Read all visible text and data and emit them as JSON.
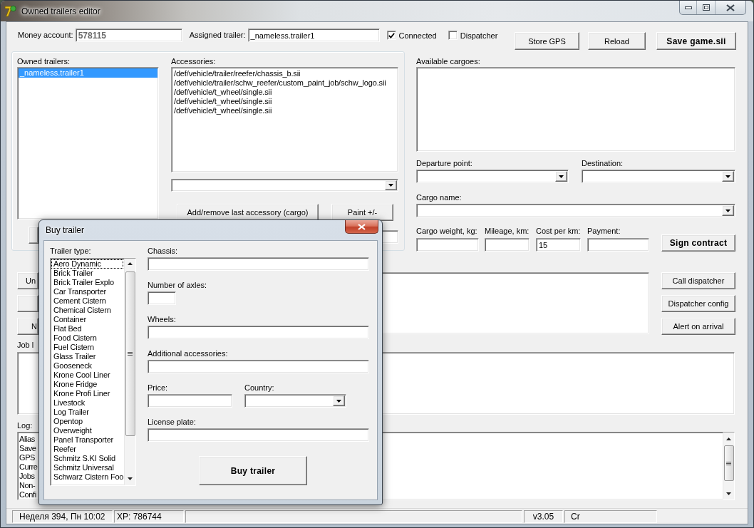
{
  "window": {
    "title": "Owned trailers editor"
  },
  "header": {
    "money_account": {
      "label": "Money account:",
      "value": "578115"
    },
    "assigned_trailer": {
      "label": "Assigned trailer:",
      "value": "_nameless.trailer1"
    },
    "checkboxes": [
      {
        "label": "Connected",
        "checked": true
      },
      {
        "label": "Dispatcher",
        "checked": false
      }
    ],
    "buttons": [
      {
        "label": "Store GPS",
        "kind": "plain"
      },
      {
        "label": "Reload",
        "kind": "plain"
      },
      {
        "label": "Save game.sii",
        "kind": "bold"
      }
    ]
  },
  "owned_trailers": {
    "label": "Owned trailers:",
    "items": [
      {
        "text": "_nameless.trailer1",
        "selected": true
      }
    ]
  },
  "accessories": {
    "label": "Accessories:",
    "items": [
      {
        "text": "/def/vehicle/trailer/reefer/chassis_b.sii",
        "selected": false
      },
      {
        "text": "/def/vehicle/trailer/schw_reefer/custom_paint_job/schw_logo.sii",
        "selected": false
      },
      {
        "text": "/def/vehicle/t_wheel/single.sii",
        "selected": false
      },
      {
        "text": "/def/vehicle/t_wheel/single.sii",
        "selected": false
      },
      {
        "text": "/def/vehicle/t_wheel/single.sii",
        "selected": false
      }
    ],
    "buttons": [
      "Add/remove last accessory (cargo)",
      "Paint +/-"
    ]
  },
  "cargo": {
    "available_label": "Available cargoes:",
    "departure_label": "Departure point:",
    "destination_label": "Destination:",
    "cargo_name_label": "Cargo name:",
    "fields": [
      {
        "label": "Cargo weight, kg:"
      },
      {
        "label": "Mileage, km:"
      },
      {
        "label": "Cost per km:",
        "value": "15"
      },
      {
        "label": "Payment:"
      }
    ],
    "sign_button": "Sign contract"
  },
  "side_buttons": [
    {
      "kind": "labeled",
      "label": "Un"
    },
    {
      "kind": "blank"
    },
    {
      "kind": "labeled",
      "label": "N"
    }
  ],
  "dispatcher_buttons": [
    "Call dispatcher",
    "Dispatcher config",
    "Alert on arrival"
  ],
  "job_log": {
    "label": "Job l"
  },
  "log": {
    "label": "Log:",
    "entries": [
      "Alias",
      "Save",
      "GPS",
      "Curre",
      "Jobs",
      "Non-",
      "Confi"
    ]
  },
  "status_bar": {
    "panels": [
      {
        "kind": "text",
        "text": "Неделя 394, Пн 10:02"
      },
      {
        "kind": "text",
        "text": "XP: 786744"
      },
      {
        "kind": "blank"
      },
      {
        "kind": "text",
        "text": "v3.05"
      },
      {
        "kind": "text",
        "text": "Cr"
      }
    ]
  },
  "buy_trailer_dialog": {
    "title": "Buy trailer",
    "trailer_type": {
      "label": "Trailer type:",
      "items": [
        {
          "text": "Aero Dynamic",
          "selected": false,
          "focused": true
        },
        {
          "text": "Brick Trailer",
          "selected": false,
          "focused": false
        },
        {
          "text": "Brick Trailer Explo",
          "selected": false,
          "focused": false
        },
        {
          "text": "Car Transporter",
          "selected": false,
          "focused": false
        },
        {
          "text": "Cement Cistern",
          "selected": false,
          "focused": false
        },
        {
          "text": "Chemical Cistern",
          "selected": false,
          "focused": false
        },
        {
          "text": "Container",
          "selected": false,
          "focused": false
        },
        {
          "text": "Flat Bed",
          "selected": false,
          "focused": false
        },
        {
          "text": "Food Cistern",
          "selected": false,
          "focused": false
        },
        {
          "text": "Fuel Cistern",
          "selected": false,
          "focused": false
        },
        {
          "text": "Glass Trailer",
          "selected": false,
          "focused": false
        },
        {
          "text": "Gooseneck",
          "selected": false,
          "focused": false
        },
        {
          "text": "Krone Cool Liner",
          "selected": false,
          "focused": false
        },
        {
          "text": "Krone Fridge",
          "selected": false,
          "focused": false
        },
        {
          "text": "Krone Profi Liner",
          "selected": false,
          "focused": false
        },
        {
          "text": "Livestock",
          "selected": false,
          "focused": false
        },
        {
          "text": "Log Trailer",
          "selected": false,
          "focused": false
        },
        {
          "text": "Opentop",
          "selected": false,
          "focused": false
        },
        {
          "text": "Overweight",
          "selected": false,
          "focused": false
        },
        {
          "text": "Panel Transporter",
          "selected": false,
          "focused": false
        },
        {
          "text": "Reefer",
          "selected": false,
          "focused": false
        },
        {
          "text": "Schmitz S.KI Solid",
          "selected": false,
          "focused": false
        },
        {
          "text": "Schmitz Universal",
          "selected": false,
          "focused": false
        },
        {
          "text": "Schwarz Cistern Foo",
          "selected": false,
          "focused": false
        }
      ]
    },
    "chassis": {
      "label": "Chassis:"
    },
    "axles": {
      "label": "Number of axles:"
    },
    "wheels": {
      "label": "Wheels:"
    },
    "additional_accessories": {
      "label": "Additional accessories:"
    },
    "price": {
      "label": "Price:"
    },
    "country": {
      "label": "Country:"
    },
    "license_plate": {
      "label": "License plate:"
    },
    "buy_button": "Buy trailer"
  }
}
